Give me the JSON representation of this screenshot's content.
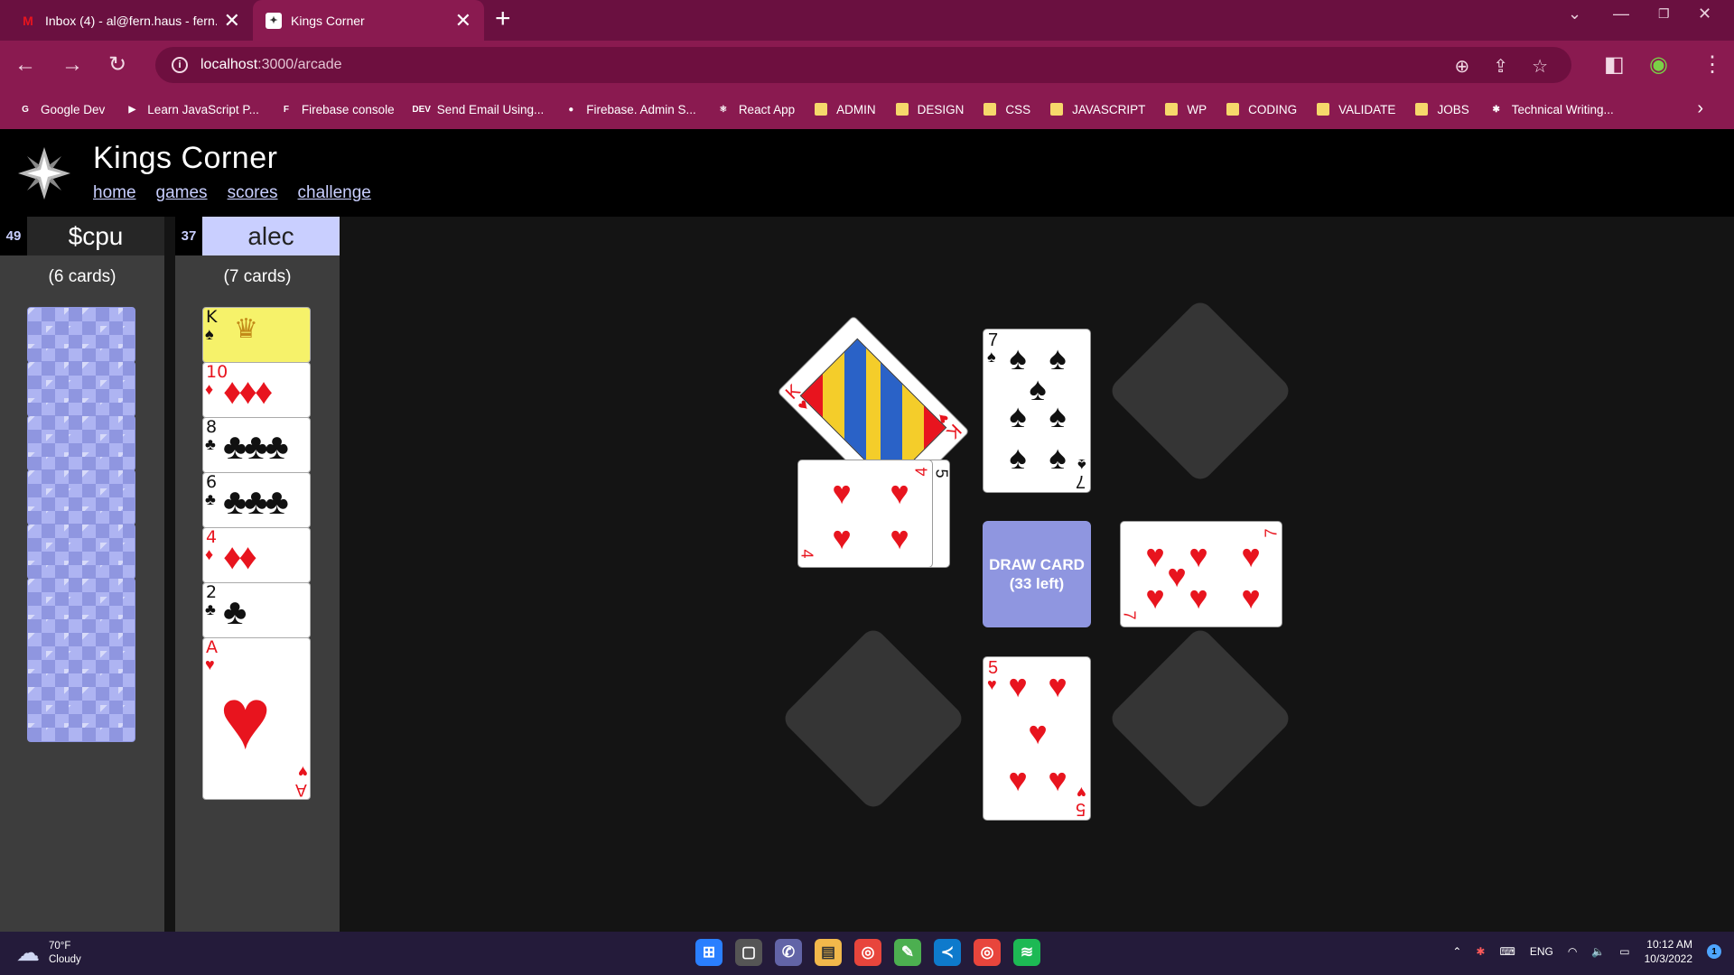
{
  "browser": {
    "tabs": [
      {
        "title": "Inbox (4) - al@fern.haus - fern.",
        "favicon": "gmail-icon",
        "active": false
      },
      {
        "title": "Kings Corner",
        "favicon": "app-icon",
        "active": true
      }
    ],
    "url_host": "localhost",
    "url_rest": ":3000/arcade",
    "bookmarks": [
      {
        "label": "Google Dev",
        "icon": "G"
      },
      {
        "label": "Learn JavaScript P...",
        "icon": "▶"
      },
      {
        "label": "Firebase console",
        "icon": "F"
      },
      {
        "label": "Send Email Using...",
        "icon": "DEV"
      },
      {
        "label": "Firebase. Admin S...",
        "icon": "●"
      },
      {
        "label": "React App",
        "icon": "⚛"
      },
      {
        "label": "ADMIN",
        "icon": "folder"
      },
      {
        "label": "DESIGN",
        "icon": "folder"
      },
      {
        "label": "CSS",
        "icon": "folder"
      },
      {
        "label": "JAVASCRIPT",
        "icon": "folder"
      },
      {
        "label": "WP",
        "icon": "folder"
      },
      {
        "label": "CODING",
        "icon": "folder"
      },
      {
        "label": "VALIDATE",
        "icon": "folder"
      },
      {
        "label": "JOBS",
        "icon": "folder"
      },
      {
        "label": "Technical Writing...",
        "icon": "✱"
      }
    ]
  },
  "app": {
    "title": "Kings Corner",
    "nav": [
      "home",
      "games",
      "scores",
      "challenge"
    ]
  },
  "players": {
    "cpu": {
      "score": "49",
      "name": "$cpu",
      "count": "(6 cards)"
    },
    "user": {
      "score": "37",
      "name": "alec",
      "count": "(7 cards)"
    }
  },
  "hand": [
    {
      "rank": "K",
      "suit": "♠",
      "color": "blk"
    },
    {
      "rank": "10",
      "suit": "♦",
      "color": "red"
    },
    {
      "rank": "8",
      "suit": "♣",
      "color": "blk"
    },
    {
      "rank": "6",
      "suit": "♣",
      "color": "blk"
    },
    {
      "rank": "4",
      "suit": "♦",
      "color": "red"
    },
    {
      "rank": "2",
      "suit": "♣",
      "color": "blk"
    },
    {
      "rank": "A",
      "suit": "♥",
      "color": "red"
    }
  ],
  "board": {
    "north": {
      "rank": "7",
      "suit": "♠"
    },
    "west_top": {
      "rank": "4",
      "suit": "♥"
    },
    "west_under": {
      "rank": "5"
    },
    "east": {
      "rank": "7",
      "suit": "♥"
    },
    "south": {
      "rank": "5",
      "suit": "♥"
    },
    "corner_nw": {
      "rank": "K",
      "suit": "♥"
    },
    "draw_label": "DRAW CARD",
    "draw_left": "(33 left)"
  },
  "taskbar": {
    "temp": "70°F",
    "condition": "Cloudy",
    "lang": "ENG",
    "time": "10:12 AM",
    "date": "10/3/2022",
    "notifications": "1"
  }
}
